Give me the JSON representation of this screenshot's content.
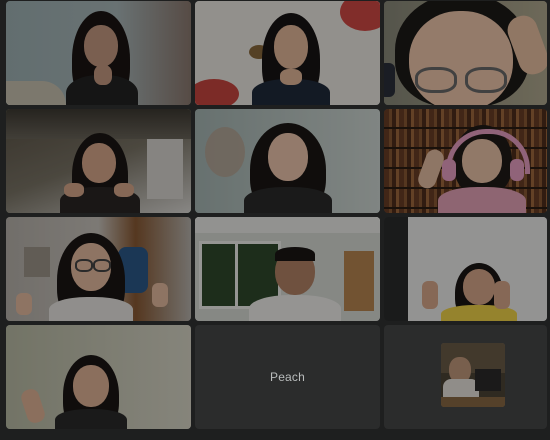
{
  "call": {
    "participants": [
      {
        "id": "p1",
        "has_video": true
      },
      {
        "id": "p2",
        "has_video": true
      },
      {
        "id": "p3",
        "has_video": true
      },
      {
        "id": "p4",
        "has_video": true
      },
      {
        "id": "p5",
        "has_video": true
      },
      {
        "id": "p6",
        "has_video": true
      },
      {
        "id": "p7",
        "has_video": true
      },
      {
        "id": "p8",
        "has_video": true
      },
      {
        "id": "p9",
        "has_video": true
      },
      {
        "id": "p10",
        "has_video": true
      },
      {
        "id": "p11",
        "has_video": false,
        "name": "Peach"
      },
      {
        "id": "p12",
        "has_video": false
      }
    ]
  },
  "colors": {
    "background": "#1e1f1f",
    "tile_empty": "#2b2c2c",
    "active_speaker_border": "#3c5b3a",
    "name_text": "#b9bcbc"
  }
}
